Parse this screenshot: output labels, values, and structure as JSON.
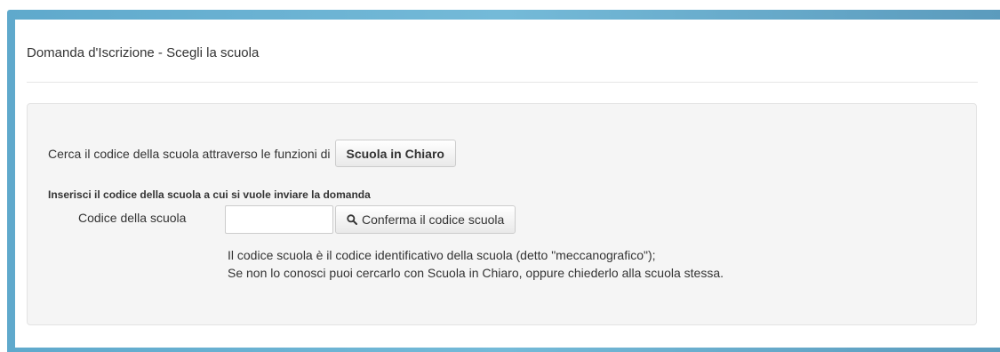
{
  "page": {
    "title": "Domanda d'Iscrizione - Scegli la scuola"
  },
  "search_row": {
    "prompt": "Cerca il codice della scuola attraverso le funzioni di",
    "scuola_in_chiaro_button": "Scuola in Chiaro"
  },
  "form": {
    "instruction": "Inserisci il codice della scuola a cui si vuole inviare la domanda",
    "codice_label": "Codice della scuola",
    "codice_value": "",
    "confirm_button": "Conferma il codice scuola",
    "confirm_icon": "search-icon"
  },
  "help": {
    "line1": "Il codice scuola è il codice identificativo della scuola (detto \"meccanografico\");",
    "line2": "Se non lo conosci puoi cercarlo con Scuola in Chiaro, oppure chiederlo alla scuola stessa."
  },
  "colors": {
    "frame_accent": "#6ab1d3",
    "well_background": "#f5f5f5"
  }
}
